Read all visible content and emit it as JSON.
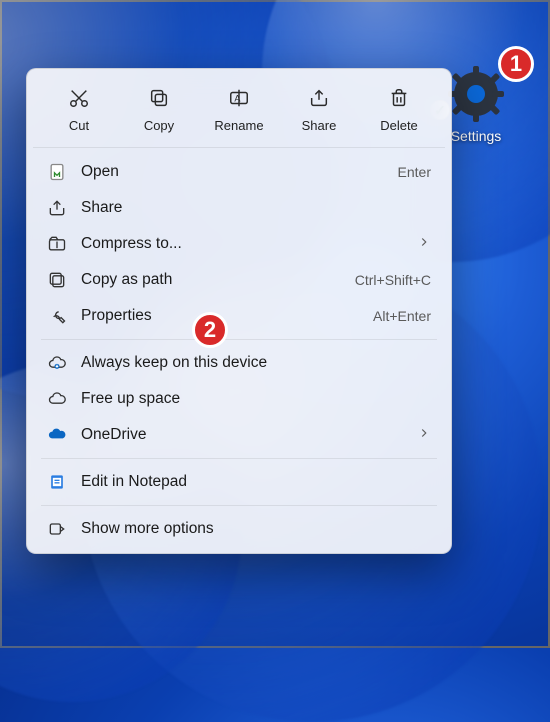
{
  "desktop": {
    "icon_label": "Settings"
  },
  "badges": {
    "b1": "1",
    "b2": "2"
  },
  "toolbar": {
    "cut": "Cut",
    "copy": "Copy",
    "rename": "Rename",
    "share": "Share",
    "delete": "Delete"
  },
  "menu": {
    "open": {
      "label": "Open",
      "hint": "Enter"
    },
    "share": {
      "label": "Share"
    },
    "compress": {
      "label": "Compress to..."
    },
    "copypath": {
      "label": "Copy as path",
      "hint": "Ctrl+Shift+C"
    },
    "properties": {
      "label": "Properties",
      "hint": "Alt+Enter"
    },
    "keep": {
      "label": "Always keep on this device"
    },
    "freeup": {
      "label": "Free up space"
    },
    "onedrive": {
      "label": "OneDrive"
    },
    "notepad": {
      "label": "Edit in Notepad"
    },
    "more": {
      "label": "Show more options"
    }
  }
}
